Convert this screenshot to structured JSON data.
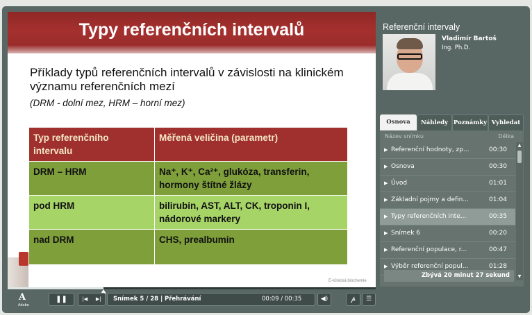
{
  "slide": {
    "title": "Typy referenčních intervalů",
    "intro": "Příklady typů referenčních intervalů v závislosti na klinickém významu referenčních mezí",
    "note": "(DRM - dolní mez, HRM – horní mez)",
    "table": {
      "headers": [
        "Typ referenčního intervalu",
        "Měřená veličina (parametr)"
      ],
      "rows": [
        [
          "DRM – HRM",
          "Na⁺, K⁺, Ca²⁺, glukóza, transferin, hormony štítné žlázy"
        ],
        [
          "pod HRM",
          "bilirubin, AST, ALT, CK, troponin I, nádorové markery"
        ],
        [
          "nad DRM",
          "CHS, prealbumin"
        ]
      ]
    },
    "watermark": "E-klinická biochemie"
  },
  "sidebar": {
    "title": "Referenční intervaly",
    "presenter_name": "Vladimír Bartoš",
    "presenter_degree": "Ing. Ph.D.",
    "tabs": [
      "Osnova",
      "Náhledy",
      "Poznámky",
      "Vyhledat"
    ],
    "list_header": {
      "name": "Název snímku",
      "length": "Délka"
    },
    "items": [
      {
        "name": "Referenční hodnoty, zp...",
        "duration": "00:30"
      },
      {
        "name": "Osnova",
        "duration": "00:30"
      },
      {
        "name": "Úvod",
        "duration": "01:01"
      },
      {
        "name": "Základní pojmy a defin...",
        "duration": "01:04"
      },
      {
        "name": "Typy referenčních inte...",
        "duration": "00:35",
        "selected": true
      },
      {
        "name": "Snímek 6",
        "duration": "00:20"
      },
      {
        "name": "Referenční populace, r...",
        "duration": "00:47"
      },
      {
        "name": "Výběr referenční popul...",
        "duration": "01:28"
      }
    ],
    "remaining": "Zbývá 20 minut 27 sekund"
  },
  "controls": {
    "logo": "A",
    "logo_sub": "Adobe",
    "play_pause_icon": "pause-icon",
    "prev_icon": "skip-previous-icon",
    "next_icon": "skip-next-icon",
    "slide_number": "Snímek 5 / 28",
    "separator": "|",
    "state": "Přehrávání",
    "time": "00:09 / 00:35",
    "volume_icon": "speaker-icon",
    "attachment_icon": "paperclip-icon",
    "menu_icon": "playlist-icon",
    "progress_fraction": 0.26
  },
  "colors": {
    "title_bar": "#a5302e",
    "table_header": "#a0302e",
    "row_dark_green": "#7e9f3a",
    "row_light_green": "#a6d467",
    "player_frame": "#586763"
  }
}
